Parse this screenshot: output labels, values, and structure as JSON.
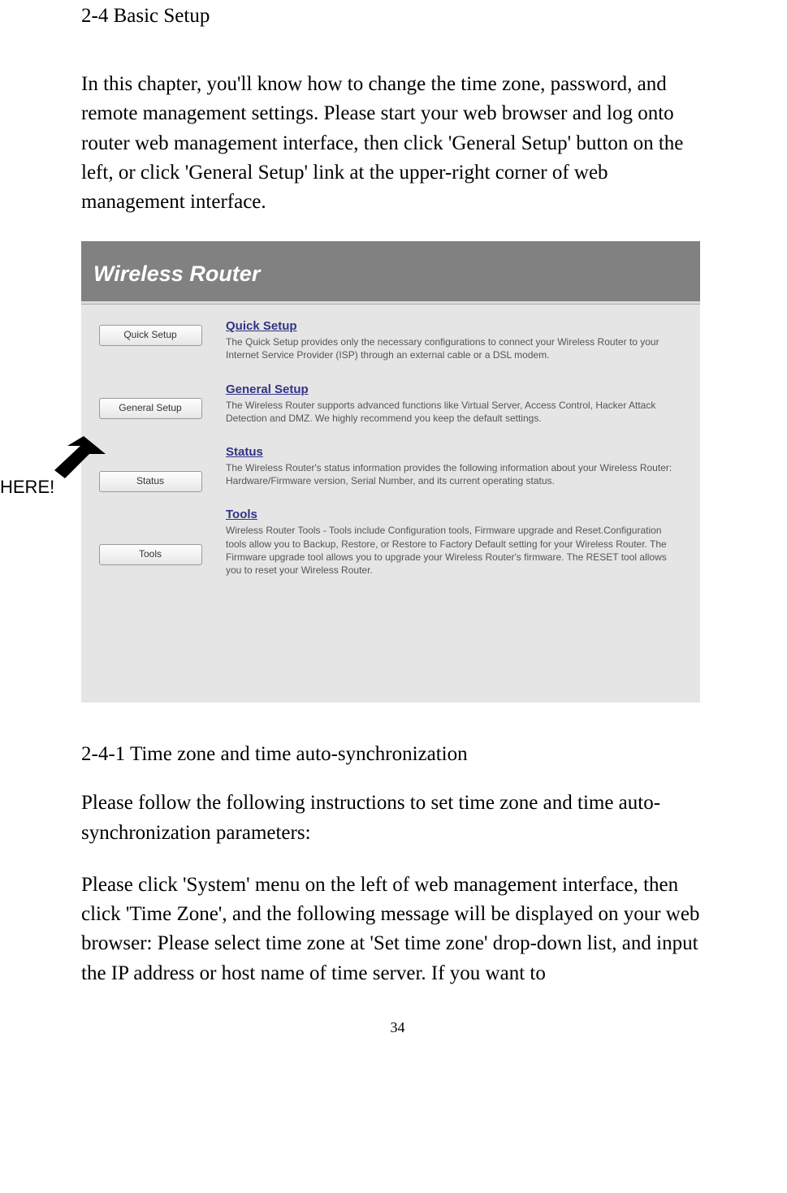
{
  "document": {
    "section_title": "2-4 Basic Setup",
    "intro": "In this chapter, you'll know how to change the time zone, password, and remote management settings. Please start your web browser and log onto router web management interface, then click 'General Setup' button on the left, or click 'General Setup' link at the upper-right corner of web management interface.",
    "callout": "HERE!",
    "subsection_title": "2-4-1 Time zone and time auto-synchronization",
    "para1": "Please follow the following instructions to set time zone and time auto-synchronization parameters:",
    "para2": "Please click 'System' menu on the left of web management interface, then click 'Time Zone', and the following message will be displayed on your web browser: Please select time zone at 'Set time zone' drop-down list, and input the IP address or host name of time server. If you want to",
    "page_number": "34"
  },
  "router": {
    "title": "Wireless Router",
    "sidebar": {
      "quick_setup": "Quick Setup",
      "general_setup": "General Setup",
      "status": "Status",
      "tools": "Tools"
    },
    "sections": [
      {
        "heading": "Quick Setup",
        "text": "The Quick Setup provides only the necessary configurations to connect your Wireless Router to your Internet Service Provider (ISP) through an external cable or a DSL modem."
      },
      {
        "heading": "General Setup",
        "text": "The Wireless Router supports advanced functions like Virtual Server, Access Control, Hacker Attack Detection and DMZ. We highly recommend you keep the default settings."
      },
      {
        "heading": "Status",
        "text": "The Wireless Router's status information provides the following information about your Wireless Router: Hardware/Firmware version, Serial Number, and its current operating status."
      },
      {
        "heading": "Tools",
        "text": "Wireless Router Tools - Tools include Configuration tools, Firmware upgrade and Reset.Configuration tools allow you to Backup, Restore, or Restore to Factory Default setting for your Wireless Router. The Firmware upgrade tool allows you to upgrade your Wireless Router's firmware. The RESET tool allows you to reset your Wireless Router."
      }
    ]
  }
}
